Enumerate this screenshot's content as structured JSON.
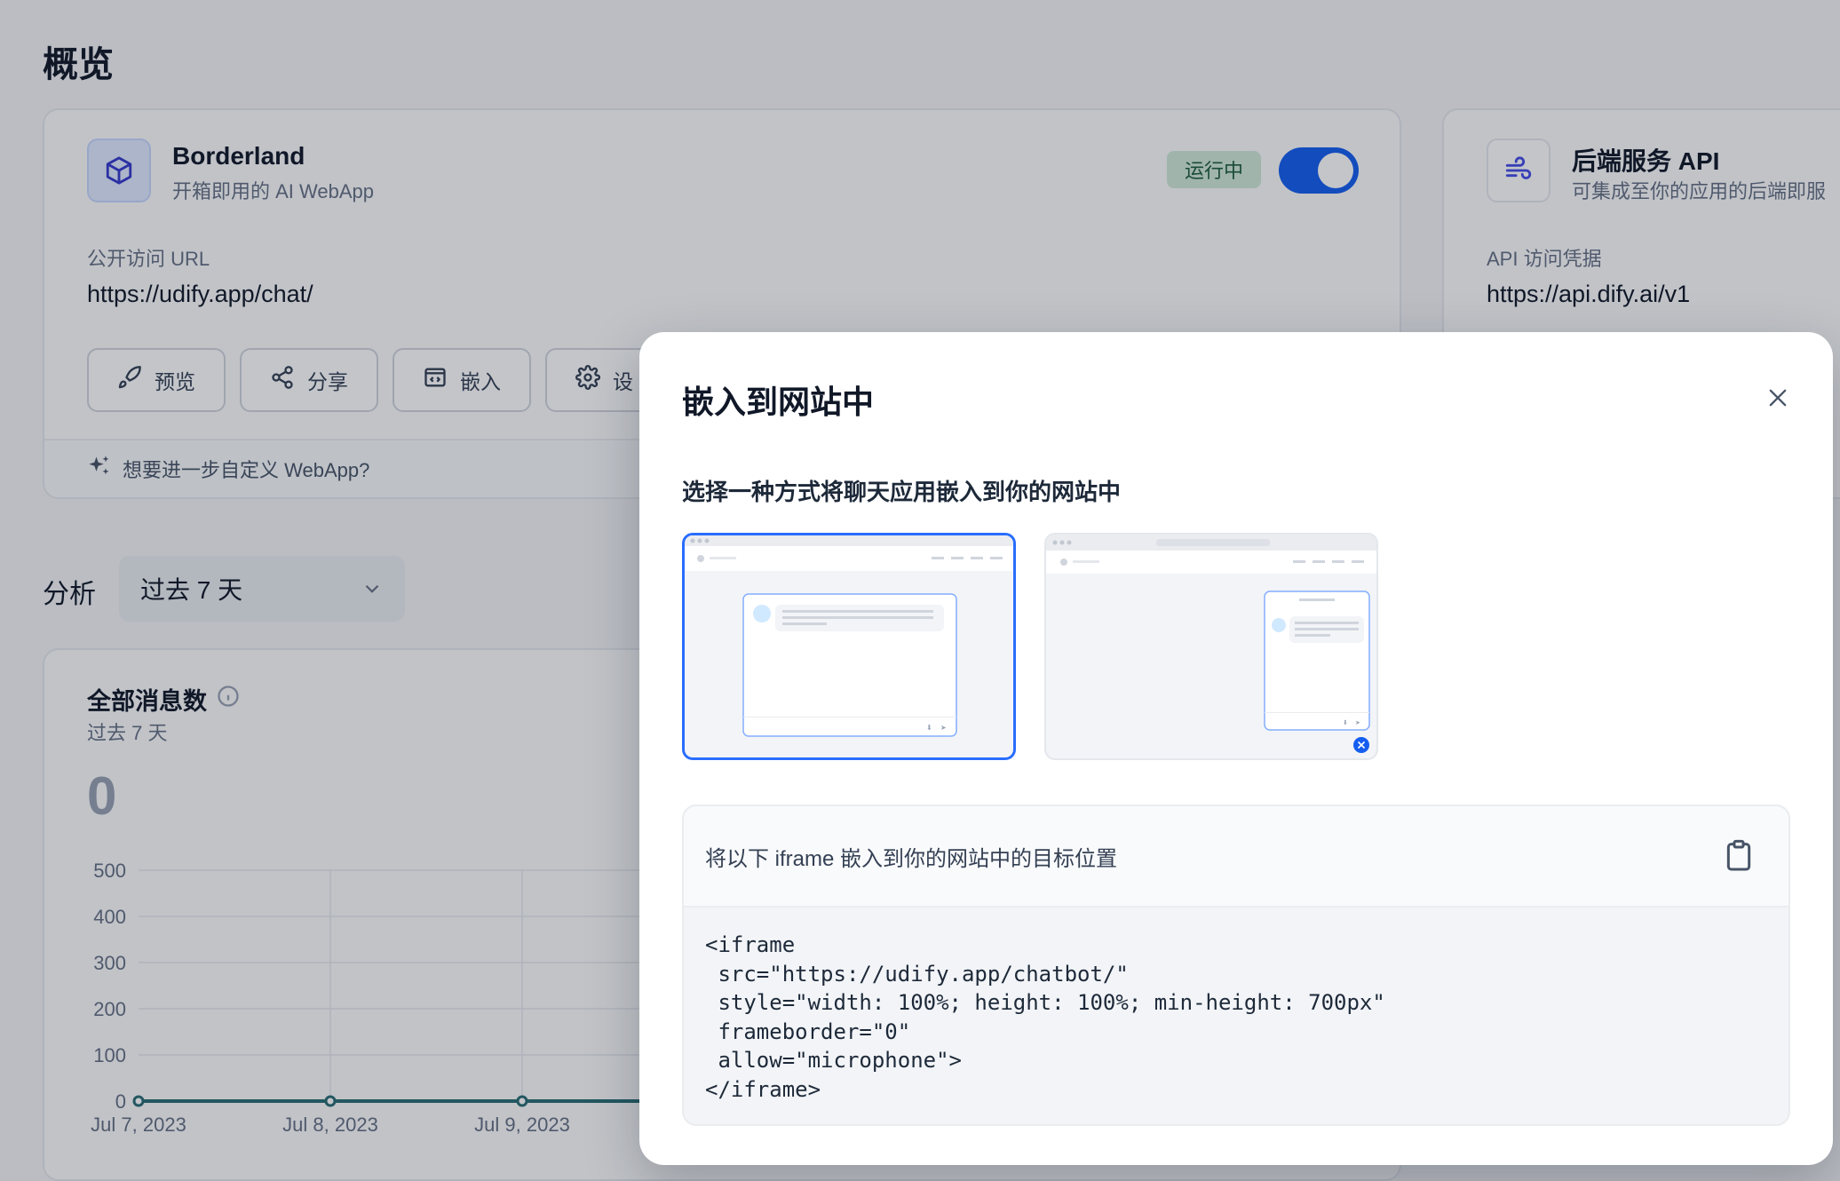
{
  "page": {
    "title": "概览"
  },
  "webapp_card": {
    "name": "Borderland",
    "subtitle": "开箱即用的 AI WebApp",
    "status": "运行中",
    "enabled": true,
    "url_label": "公开访问 URL",
    "url": "https://udify.app/chat/",
    "actions": [
      {
        "label": "预览",
        "icon": "rocket-icon"
      },
      {
        "label": "分享",
        "icon": "share-icon"
      },
      {
        "label": "嵌入",
        "icon": "embed-icon"
      },
      {
        "label": "设",
        "icon": "gear-icon"
      }
    ],
    "footer": "想要进一步自定义 WebApp?"
  },
  "api_card": {
    "name": "后端服务 API",
    "subtitle": "可集成至你的应用的后端即服",
    "label": "API 访问凭据",
    "url": "https://api.dify.ai/v1"
  },
  "analysis": {
    "title": "分析",
    "range": "过去 7 天"
  },
  "chart_data": {
    "type": "line",
    "title": "全部消息数",
    "subtitle": "过去 7 天",
    "total": "0",
    "x": [
      "Jul 7, 2023",
      "Jul 8, 2023",
      "Jul 9, 2023"
    ],
    "series": [
      {
        "values": [
          0,
          0,
          0
        ]
      }
    ],
    "ylim": [
      0,
      500
    ],
    "yticks": [
      "500",
      "400",
      "300",
      "200",
      "100",
      "0"
    ],
    "grid": true,
    "line_color": "#2a6d73"
  },
  "modal": {
    "title": "嵌入到网站中",
    "subtitle": "选择一种方式将聊天应用嵌入到你的网站中",
    "code_title": "将以下 iframe 嵌入到你的网站中的目标位置",
    "code_lines": [
      "<iframe",
      " src=\"https://udify.app/chatbot/\"",
      " style=\"width: 100%; height: 100%; min-height: 700px\"",
      " frameborder=\"0\"",
      " allow=\"microphone\">",
      "</iframe>"
    ],
    "accent": "#296dff"
  }
}
